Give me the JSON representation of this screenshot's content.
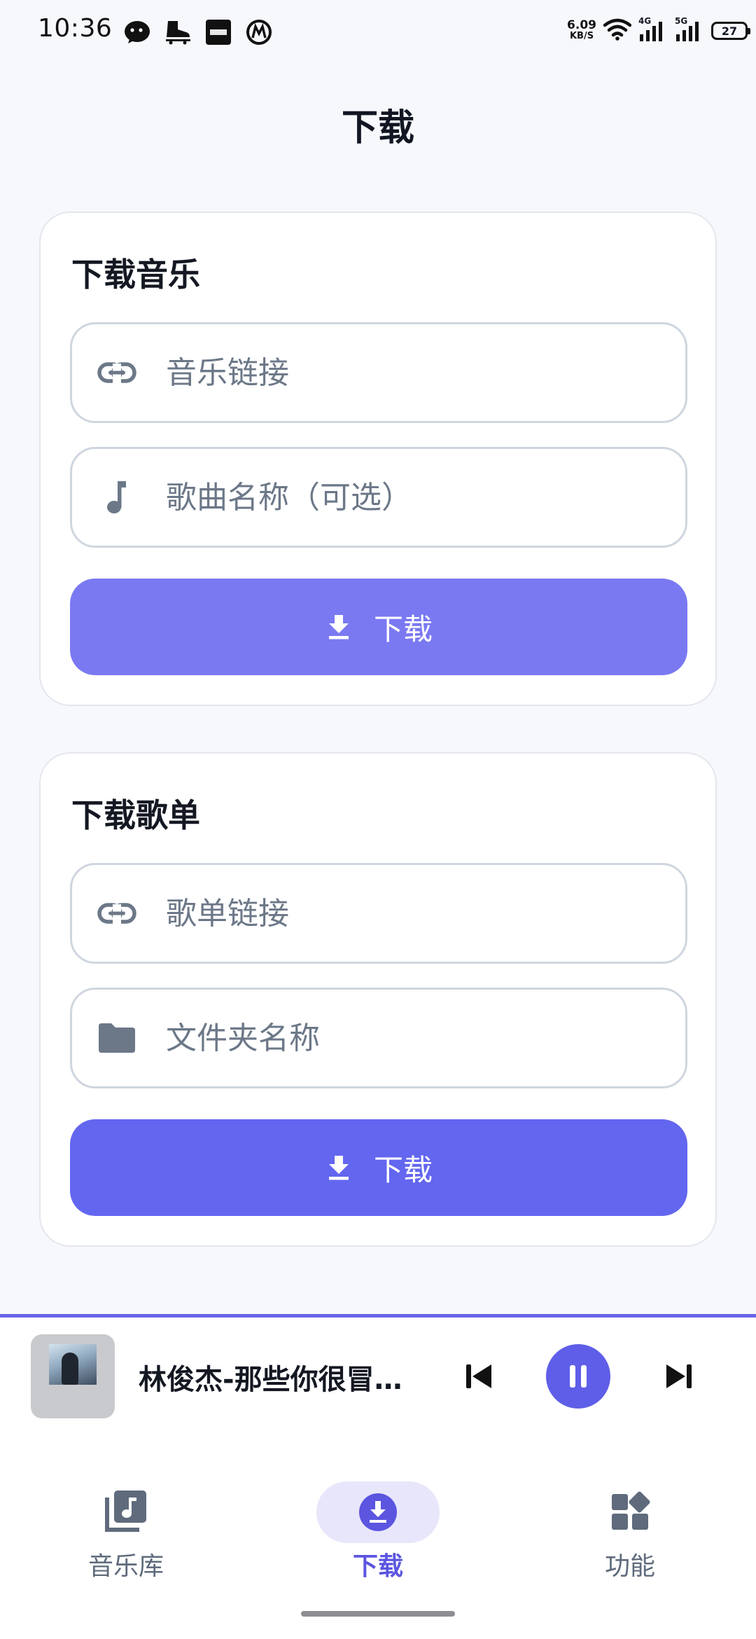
{
  "status_bar": {
    "time": "10:36",
    "net_speed_value": "6.09",
    "net_speed_unit": "KB/S",
    "signal_1_label": "4G",
    "signal_2_label": "5G",
    "battery": "27",
    "left_icons": [
      "wechat-icon",
      "skate-icon",
      "xiaohongshu-icon",
      "metro-icon"
    ]
  },
  "page": {
    "title": "下载"
  },
  "download_music": {
    "title": "下载音乐",
    "link_placeholder": "音乐链接",
    "name_placeholder": "歌曲名称（可选）",
    "button_label": "下载",
    "button_color": "#7a79f2"
  },
  "download_playlist": {
    "title": "下载歌单",
    "link_placeholder": "歌单链接",
    "folder_placeholder": "文件夹名称",
    "button_label": "下载",
    "button_color": "#6366ef"
  },
  "player": {
    "song_title": "林俊杰-那些你很冒…",
    "state": "playing",
    "accent": "#5f5ee8"
  },
  "nav": {
    "items": [
      {
        "label": "音乐库",
        "icon": "music-library-icon",
        "active": false
      },
      {
        "label": "下载",
        "icon": "download-circle-icon",
        "active": true
      },
      {
        "label": "功能",
        "icon": "widgets-icon",
        "active": false
      }
    ],
    "active_color": "#5b55e0"
  }
}
